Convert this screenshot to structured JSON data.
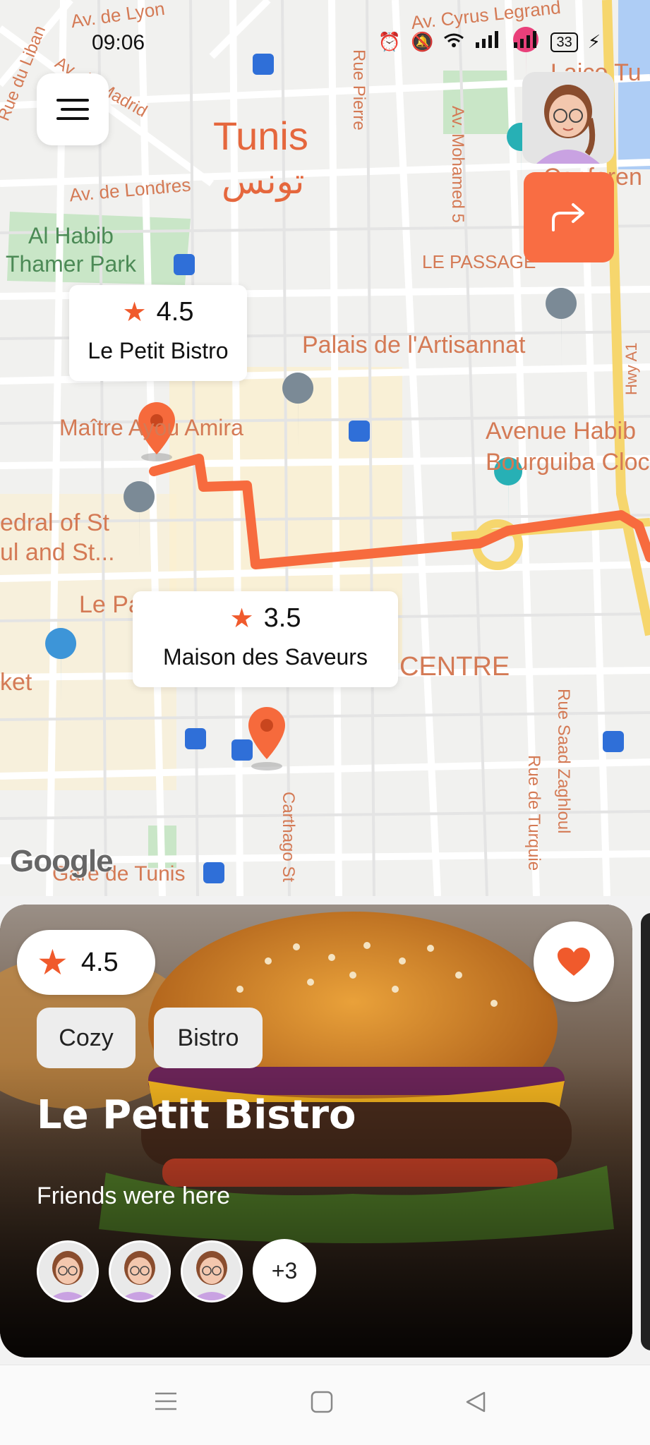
{
  "status_bar": {
    "time": "09:06",
    "battery": "33"
  },
  "map": {
    "labels": {
      "tunis": "Tunis",
      "tunis_ar": "تونس",
      "av_de_lyon": "Av. de Lyon",
      "av_cyrus": "Av. Cyrus Legrand",
      "rue_du_liban": "Rue du Liban",
      "av_madrid": "Av. de Madrid",
      "av_londres": "Av. de Londres",
      "park_1": "Al Habib",
      "park_2": "Thamer Park",
      "rue_pierre": "Rue Pierre",
      "av_mohamed": "Av. Mohamed 5",
      "le_passage": "LE PASSAGE",
      "palais": "Palais de l'Artisannat",
      "hwy": "Hwy A1",
      "maitre": "Maître Ayou Amira",
      "avenue_1": "Avenue Habib",
      "avenue_2": "Bourguiba Cloc",
      "cathedral_1": "edral of St",
      "cathedral_2": "ul and St...",
      "le_pa": "Le Pa",
      "centre": "CENTRE",
      "ket": "ket",
      "rue_saad": "Rue Saad Zaghloul",
      "rue_turquie": "Rue de Turquie",
      "carthago": "Carthago St",
      "gare": "Gare de Tunis",
      "laico": "Laico Tu",
      "conferen": "Conferen",
      "google": "Google"
    },
    "marker_1": {
      "rating": "4.5",
      "name": "Le Petit Bistro"
    },
    "marker_2": {
      "rating": "3.5",
      "name": "Maison des Saveurs"
    }
  },
  "card": {
    "rating": "4.5",
    "tags": [
      "Cozy",
      "Bistro"
    ],
    "title": "Le Petit Bistro",
    "subtitle": "Friends were here",
    "more_friends": "+3"
  },
  "colors": {
    "accent": "#f96d43",
    "route": "#f76b3e"
  },
  "icons": [
    "menu-icon",
    "avatar-icon",
    "directions-icon",
    "star-icon",
    "heart-icon",
    "nav-menu-icon",
    "nav-home-icon",
    "nav-back-icon"
  ]
}
